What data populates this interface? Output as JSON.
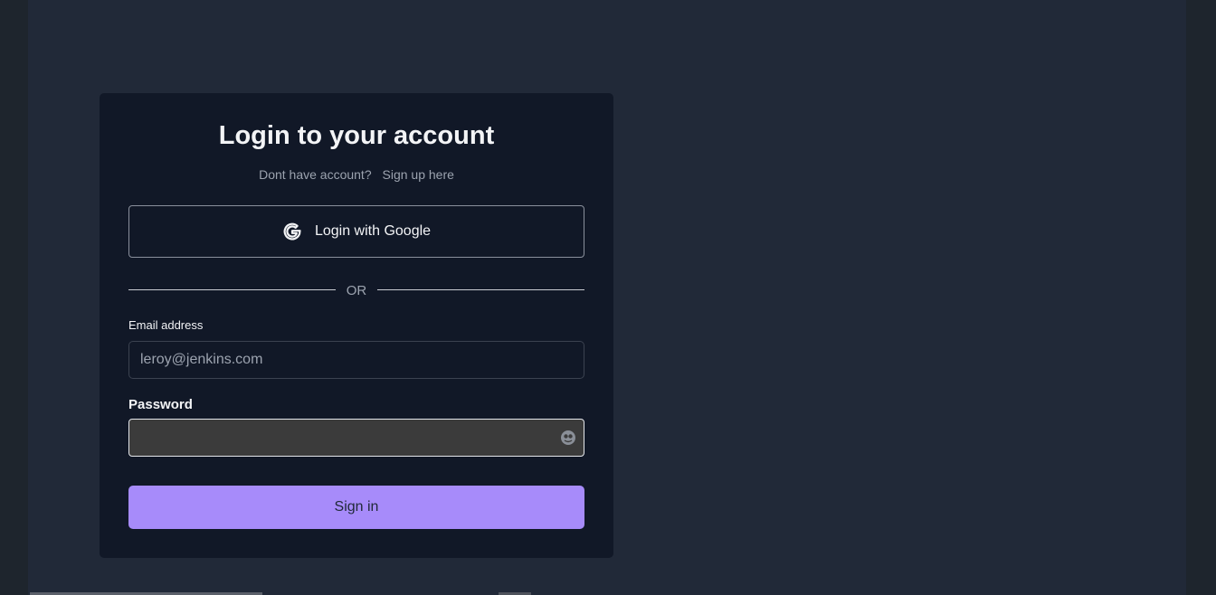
{
  "login": {
    "title": "Login to your account",
    "no_account_text": "Dont have account?",
    "signup_link": "Sign up here",
    "google_button": "Login with Google",
    "divider_text": "OR",
    "email": {
      "label": "Email address",
      "value": "",
      "placeholder": "leroy@jenkins.com"
    },
    "password": {
      "label": "Password",
      "value": "",
      "icon": "password-manager-icon"
    },
    "signin_button": "Sign in"
  },
  "colors": {
    "background": "#212938",
    "card": "#111827",
    "accent": "#a78bfa"
  }
}
